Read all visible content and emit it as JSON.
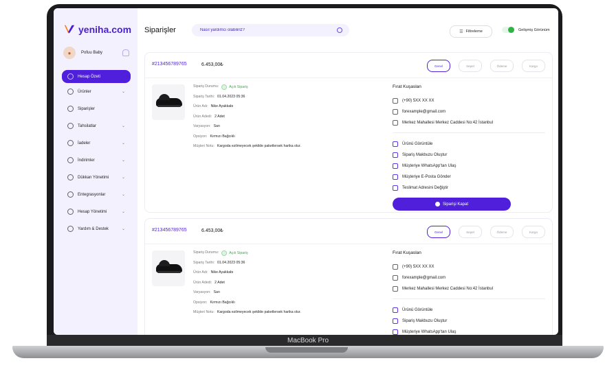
{
  "device": {
    "label": "MacBook Pro"
  },
  "sidebar": {
    "logo": "yeniha.com",
    "profile_name": "Pofuu Baby",
    "items": [
      {
        "label": "Hesap Özeti",
        "active": true,
        "has_chevron": false
      },
      {
        "label": "Ürünler",
        "active": false,
        "has_chevron": true
      },
      {
        "label": "Siparişler",
        "active": false,
        "has_chevron": false
      },
      {
        "label": "Tahsilatlar",
        "active": false,
        "has_chevron": true
      },
      {
        "label": "İadeler",
        "active": false,
        "has_chevron": true
      },
      {
        "label": "İndirimler",
        "active": false,
        "has_chevron": true
      },
      {
        "label": "Dükkan Yönetimi",
        "active": false,
        "has_chevron": true
      },
      {
        "label": "Entegrasyonlar",
        "active": false,
        "has_chevron": true
      },
      {
        "label": "Hesap Yönetimi",
        "active": false,
        "has_chevron": true
      },
      {
        "label": "Yardım & Destek",
        "active": false,
        "has_chevron": true
      }
    ]
  },
  "header": {
    "title": "Siparişler",
    "search_placeholder": "Nasıl yardımcı olabiliriz?",
    "filter_label": "Filtreleme",
    "advanced_view_label": "Gelişmiş Görünüm"
  },
  "orders": [
    {
      "id": "#213456789765",
      "amount": "6.453,00₺",
      "tabs": [
        "Genel",
        "Sepet",
        "Ödeme",
        "Kargo"
      ],
      "labels": {
        "status": "Sipariş Durumu:",
        "date": "Sipariş Tarihi:",
        "product": "Ürün Adı:",
        "qty": "Ürün Adedi:",
        "variant": "Varyasyon:",
        "option": "Opsiyon:",
        "note": "Müşteri Notu:"
      },
      "status": "Açık Sipariş",
      "date": "01.04.2023 05:36",
      "product": "Nike Ayakkabı",
      "qty": "2 Adet",
      "variant": "Sarı",
      "option": "Kırmızı Bağcıklı",
      "note": "Kargoda ezilmeyecek şekilde paketlersek harika olur.",
      "customer": {
        "name": "Fırat Kuşaslan",
        "phone": "(+90) 5XX XX XX",
        "email": "forexample@gmail.com",
        "address": "Merkez Mahallesi Merkez Caddesi No:42 İstanbul"
      },
      "actions": [
        "Ürünü Görüntüle",
        "Sipariş Makbuzu Oluştur",
        "Müşteriye WhatsApp'tan Ulaş",
        "Müşteriye E-Posta Gönder",
        "Teslimat Adresini Değiştir"
      ],
      "close_label": "Siparişi Kapat"
    },
    {
      "id": "#213456789765",
      "amount": "6.453,00₺",
      "tabs": [
        "Genel",
        "Sepet",
        "Ödeme",
        "Kargo"
      ],
      "labels": {
        "status": "Sipariş Durumu:",
        "date": "Sipariş Tarihi:",
        "product": "Ürün Adı:",
        "qty": "Ürün Adedi:",
        "variant": "Varyasyon:",
        "option": "Opsiyon:",
        "note": "Müşteri Notu:"
      },
      "status": "Açık Sipariş",
      "date": "01.04.2023 05:36",
      "product": "Nike Ayakkabı",
      "qty": "2 Adet",
      "variant": "Sarı",
      "option": "Kırmızı Bağcıklı",
      "note": "Kargoda ezilmeyecek şekilde paketlersek harika olur.",
      "customer": {
        "name": "Fırat Kuşaslan",
        "phone": "(+90) 5XX XX XX",
        "email": "forexample@gmail.com",
        "address": "Merkez Mahallesi Merkez Caddesi No:42 İstanbul"
      },
      "actions": [
        "Ürünü Görüntüle",
        "Sipariş Makbuzu Oluştur",
        "Müşteriye WhatsApp'tan Ulaş"
      ]
    }
  ],
  "colors": {
    "accent": "#4f1fdc",
    "success": "#2fb344",
    "sidebar_bg": "#f3f1fd"
  }
}
